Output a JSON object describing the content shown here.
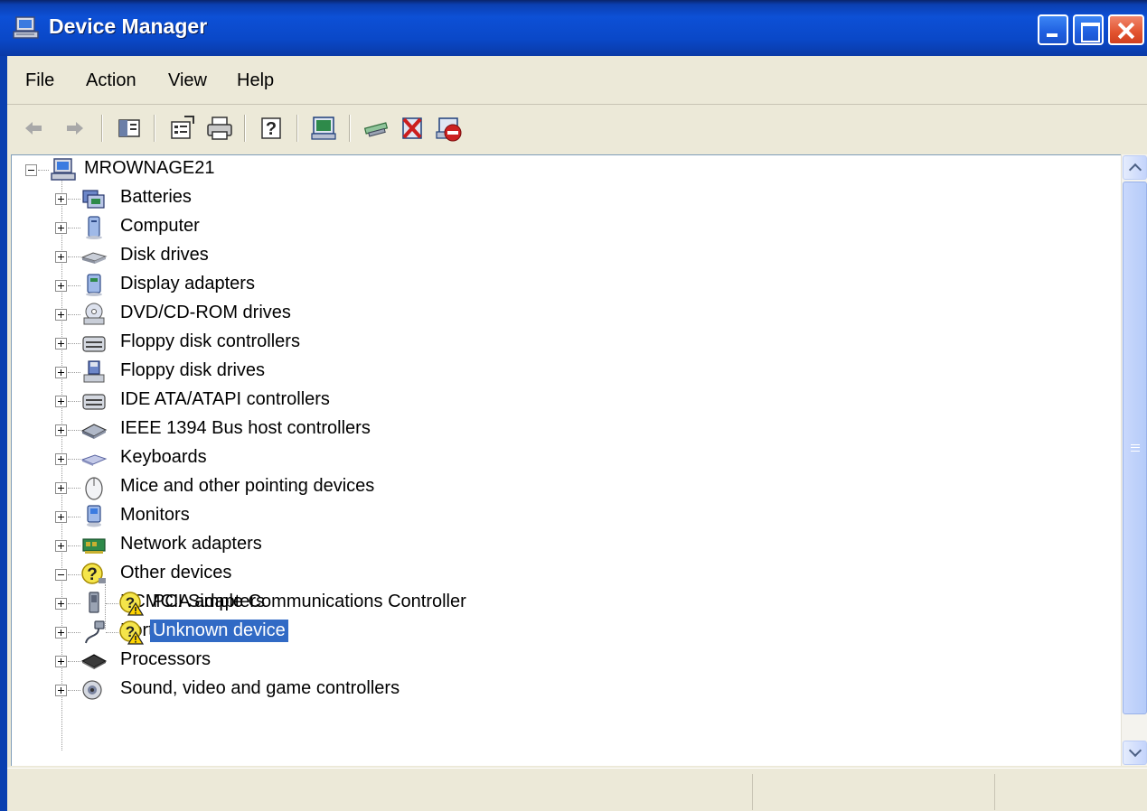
{
  "window": {
    "title": "Device Manager"
  },
  "menubar": {
    "items": [
      {
        "label": "File"
      },
      {
        "label": "Action"
      },
      {
        "label": "View"
      },
      {
        "label": "Help"
      }
    ]
  },
  "toolbar": {
    "buttons": [
      {
        "name": "back-icon"
      },
      {
        "name": "forward-icon"
      },
      {
        "name": "show-hide-console-tree-icon"
      },
      {
        "name": "properties-icon"
      },
      {
        "name": "print-icon"
      },
      {
        "name": "help-icon"
      },
      {
        "name": "scan-hardware-changes-icon"
      },
      {
        "name": "update-driver-icon"
      },
      {
        "name": "uninstall-icon"
      },
      {
        "name": "disable-icon"
      }
    ]
  },
  "tree": {
    "root": {
      "label": "MROWNAGE21",
      "expanded": true
    },
    "categories": [
      {
        "label": "Batteries",
        "icon": "battery-icon"
      },
      {
        "label": "Computer",
        "icon": "computer-icon"
      },
      {
        "label": "Disk drives",
        "icon": "disk-drive-icon"
      },
      {
        "label": "Display adapters",
        "icon": "display-adapter-icon"
      },
      {
        "label": "DVD/CD-ROM drives",
        "icon": "cd-drive-icon"
      },
      {
        "label": "Floppy disk controllers",
        "icon": "controller-icon"
      },
      {
        "label": "Floppy disk drives",
        "icon": "floppy-drive-icon"
      },
      {
        "label": "IDE ATA/ATAPI controllers",
        "icon": "controller-icon"
      },
      {
        "label": "IEEE 1394 Bus host controllers",
        "icon": "bus-controller-icon"
      },
      {
        "label": "Keyboards",
        "icon": "keyboard-icon"
      },
      {
        "label": "Mice and other pointing devices",
        "icon": "mouse-icon"
      },
      {
        "label": "Monitors",
        "icon": "monitor-icon"
      },
      {
        "label": "Network adapters",
        "icon": "network-adapter-icon"
      },
      {
        "label": "Other devices",
        "icon": "unknown-device-icon",
        "expanded": true,
        "children": [
          {
            "label": "PCI Simple Communications Controller",
            "icon": "warning-device-icon"
          },
          {
            "label": "Unknown device",
            "icon": "warning-device-icon",
            "selected": true
          }
        ]
      },
      {
        "label": "PCMCIA adapters",
        "icon": "pcmcia-icon"
      },
      {
        "label": "Ports (COM & LPT)",
        "icon": "port-icon"
      },
      {
        "label": "Processors",
        "icon": "processor-icon"
      },
      {
        "label": "Sound, video and game controllers",
        "icon": "sound-icon"
      }
    ]
  },
  "colors": {
    "titlebar": "#0d50d6",
    "selection": "#316ac5",
    "window_face": "#ece9d8"
  }
}
